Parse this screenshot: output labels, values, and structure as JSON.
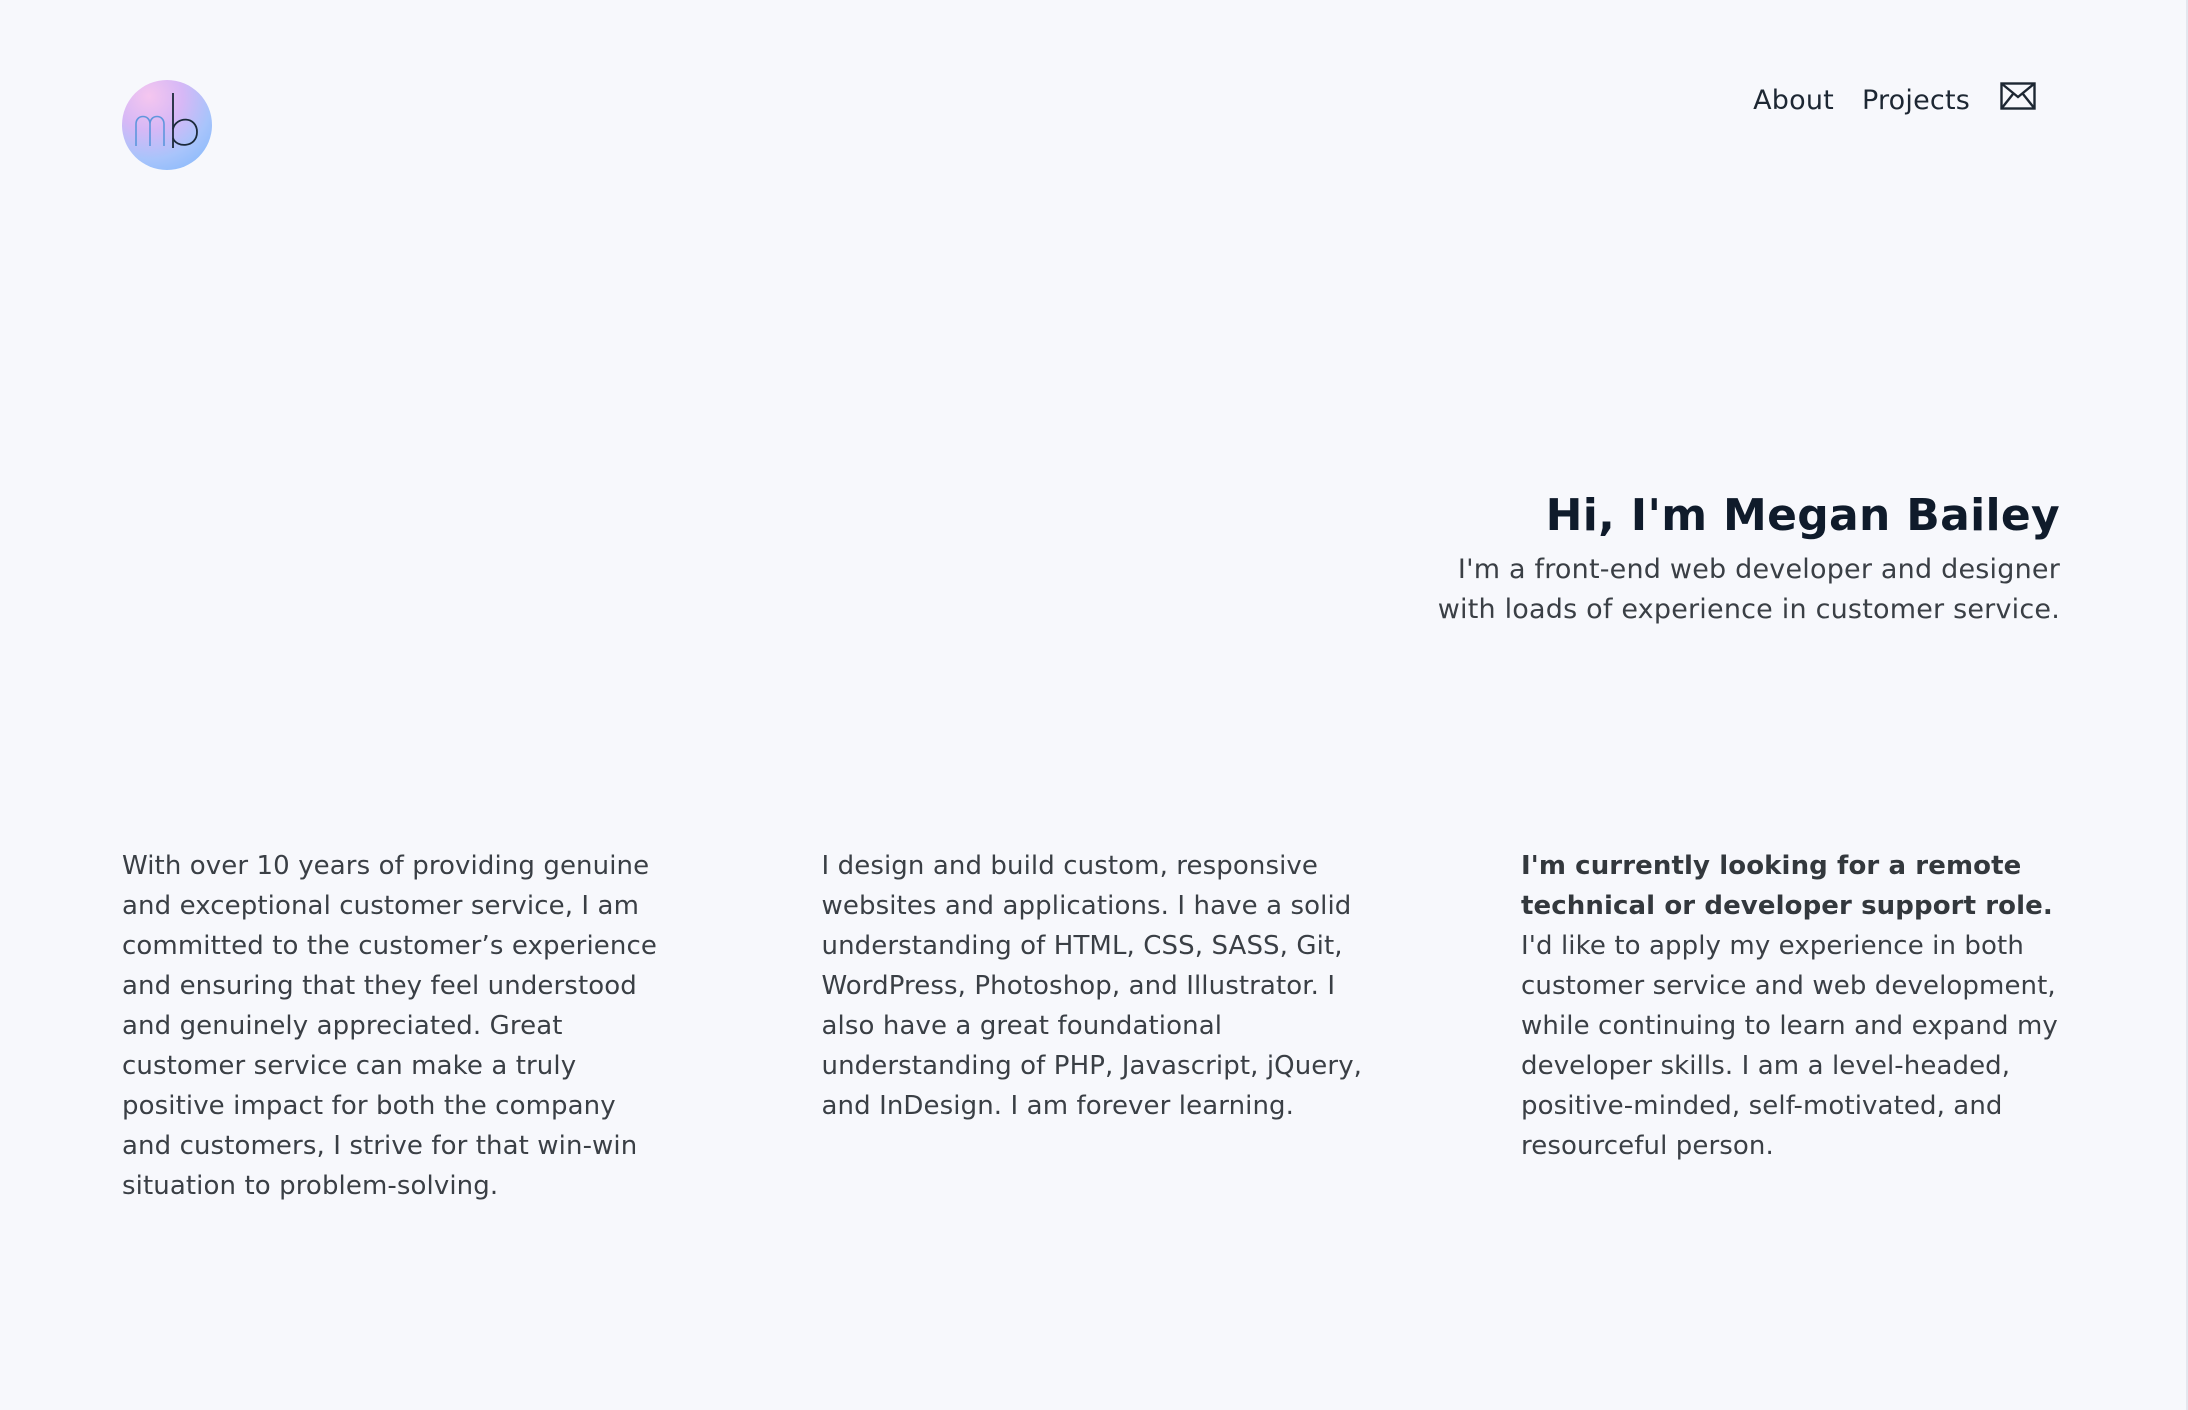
{
  "nav": {
    "about_label": "About",
    "projects_label": "Projects",
    "mail_icon": "envelope-icon"
  },
  "logo": {
    "text": "mb",
    "gradient_colors": [
      "#f5c6ef",
      "#d6b8f6",
      "#a8c4fb",
      "#7db6fb"
    ]
  },
  "hero": {
    "heading": "Hi, I'm Megan Bailey",
    "subtitle_line1": "I'm a front-end web developer and designer",
    "subtitle_line2": "with loads of experience in customer service."
  },
  "columns": [
    {
      "text": "With over 10 years of providing genuine and exceptional customer service, I am committed to the customer’s experience and ensuring that they feel understood and genuinely appreciated. Great customer service can make a truly positive impact for both the company and customers, I strive for that win-win situation to problem-solving."
    },
    {
      "text": "I design and build custom, responsive websites and applications. I have a solid understanding of HTML, CSS, SASS, Git, WordPress, Photoshop, and Illustrator. I also have a great foundational understanding of PHP, Javascript, jQuery, and InDesign. I am forever learning."
    },
    {
      "bold": "I'm currently looking for a remote technical or developer support role.",
      "text": "I'd like to apply my experience in both customer service and web development, while continuing to learn and expand my developer skills. I am a level-headed, positive-minded, self-motivated, and resourceful person."
    }
  ],
  "colors": {
    "background": "#f7f8fc",
    "heading": "#0f1b2b",
    "body_text": "#3a3f45"
  }
}
